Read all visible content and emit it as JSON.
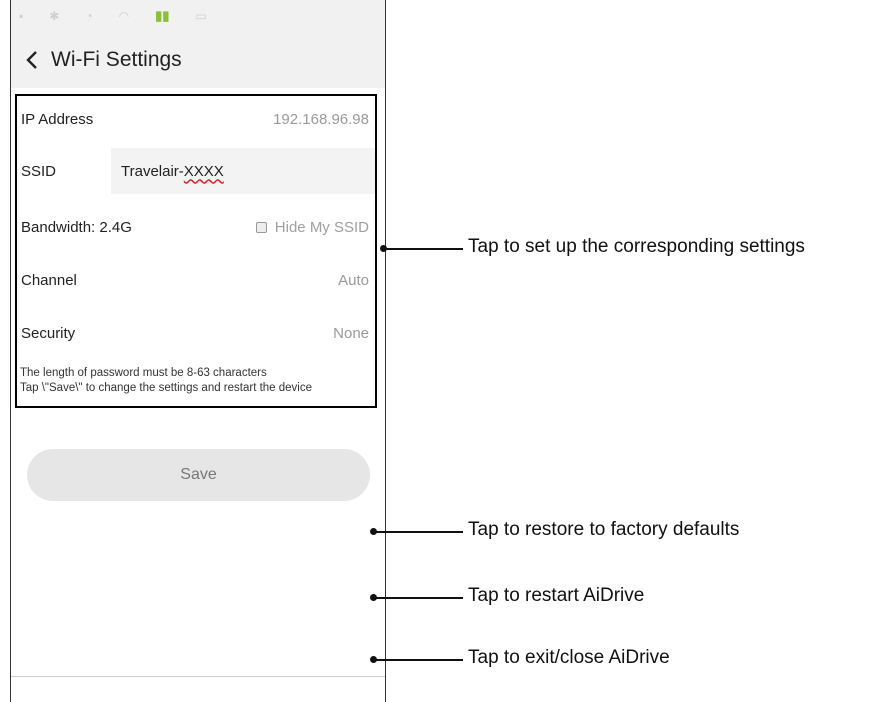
{
  "header": {
    "title": "Wi-Fi Settings"
  },
  "settings": {
    "ip_label": "IP Address",
    "ip_value": "192.168.96.98",
    "ssid_label": "SSID",
    "ssid_prefix": "Travelair- ",
    "ssid_suffix": "XXXX",
    "bandwidth_label": "Bandwidth: 2.4G",
    "hide_ssid_label": "Hide My SSID",
    "hide_ssid_checked": false,
    "channel_label": "Channel",
    "channel_value": "Auto",
    "security_label": "Security",
    "security_value": "None",
    "note_line1": "The length of password must be 8-63 characters",
    "note_line2": "Tap \\\"Save\\\" to change the settings and restart the device"
  },
  "save_label": "Save",
  "callouts": {
    "settings": "Tap to set up the corresponding settings",
    "restore": "Tap to restore to factory defaults",
    "restart": "Tap to restart AiDrive",
    "exit": "Tap to exit/close AiDrive"
  },
  "colors": {
    "signal": "#8bbf3a",
    "appbar_bg": "#f1f1f1",
    "button_bg": "#e6e6e6"
  }
}
